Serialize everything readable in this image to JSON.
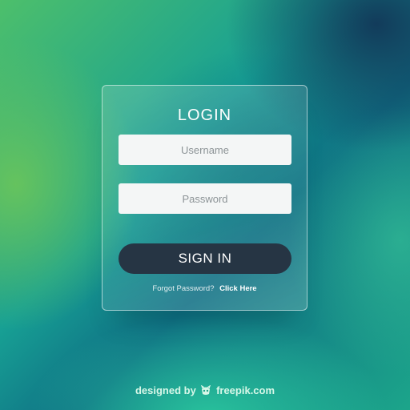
{
  "login_card": {
    "title": "LOGIN",
    "username_placeholder": "Username",
    "password_placeholder": "Password",
    "signin_label": "SIGN IN",
    "forgot_text": "Forgot Password?",
    "click_here_label": "Click Here"
  },
  "credit": {
    "designed_by": "designed by",
    "brand": "freepik.com",
    "brand_icon": "freepik-logo-icon"
  },
  "colors": {
    "button_bg": "#263544",
    "field_bg": "#f4f6f6",
    "text_light": "#ffffff"
  }
}
